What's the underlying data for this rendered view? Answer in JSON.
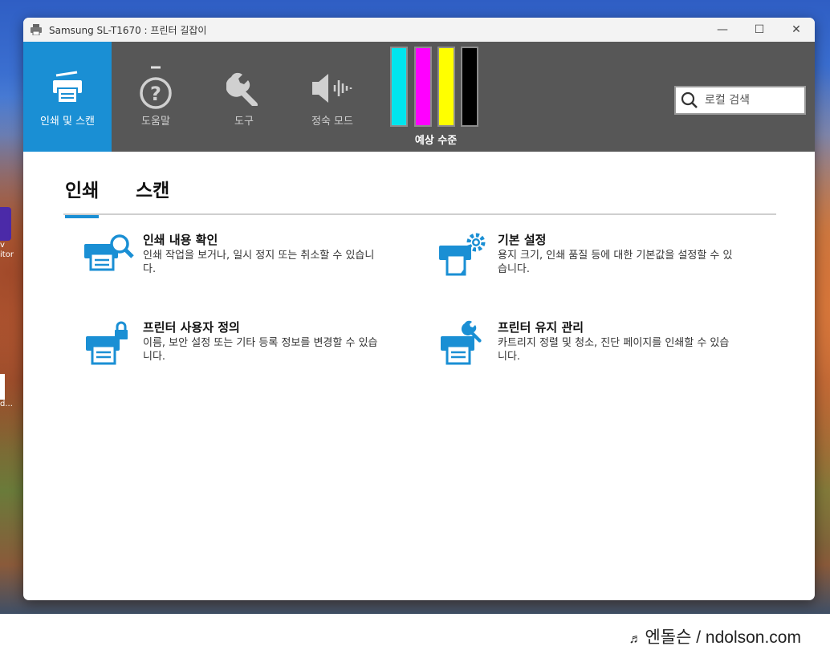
{
  "window": {
    "title": "Samsung SL-T1670 : 프린터 길잡이",
    "controls": {
      "minimize": "—",
      "maximize": "☐",
      "close": "✕"
    }
  },
  "nav": {
    "items": [
      {
        "label": "인쇄 및 스캔",
        "icon": "print-scan-icon",
        "active": true
      },
      {
        "label": "도움말",
        "icon": "help-icon",
        "active": false
      },
      {
        "label": "도구",
        "icon": "wrench-icon",
        "active": false
      },
      {
        "label": "정숙 모드",
        "icon": "quiet-mode-icon",
        "active": false
      }
    ]
  },
  "ink": {
    "label": "예상 수준",
    "cartridges": [
      {
        "name": "cyan",
        "color": "#00e5ee"
      },
      {
        "name": "magenta",
        "color": "#ff00ff"
      },
      {
        "name": "yellow",
        "color": "#ffff00"
      },
      {
        "name": "black",
        "color": "#000000"
      }
    ]
  },
  "search": {
    "placeholder": "로컬 검색"
  },
  "tabs": [
    {
      "label": "인쇄",
      "active": true
    },
    {
      "label": "스캔",
      "active": false
    }
  ],
  "cards": {
    "print_view": {
      "title": "인쇄 내용 확인",
      "desc": "인쇄 작업을 보거나, 일시 정지 또는 취소할 수 있습니다."
    },
    "default_settings": {
      "title": "기본 설정",
      "desc": "용지 크기, 인쇄 품질 등에 대한 기본값을 설정할 수 있습니다."
    },
    "customize": {
      "title": "프린터 사용자 정의",
      "desc": "이름, 보안 설정 또는 기타 등록 정보를 변경할 수 있습니다."
    },
    "maintenance": {
      "title": "프린터 유지 관리",
      "desc": "카트리지 정렬 및 청소, 진단 페이지를 인쇄할 수 있습니다."
    }
  },
  "desktop": {
    "icon1_text": "v\nitor",
    "icon2_text": "d..."
  },
  "watermark": {
    "note": "♬",
    "text": "엔돌슨 / ndolson.com"
  },
  "colors": {
    "accent": "#1a8fd4",
    "toolbar": "#575757"
  }
}
